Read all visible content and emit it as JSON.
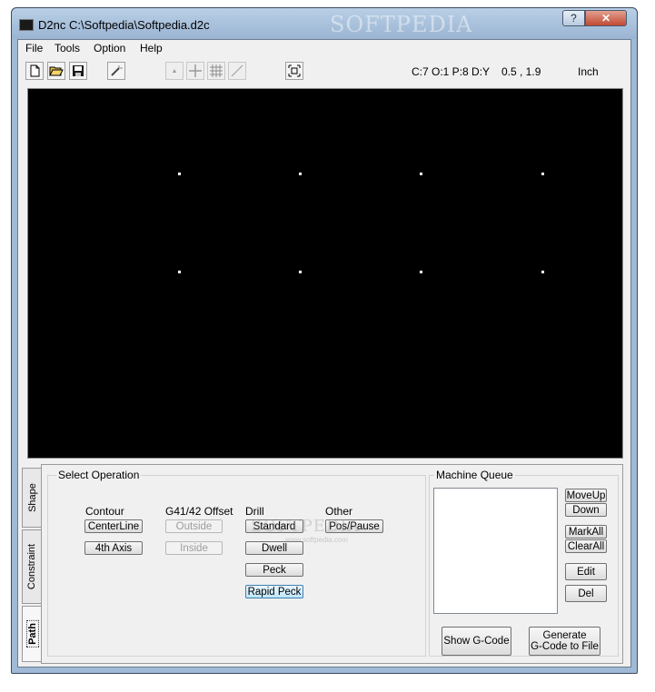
{
  "window": {
    "title": "D2nc C:\\Softpedia\\Softpedia.d2c",
    "watermark": "SOFTPEDIA",
    "help_button": "?",
    "close_button": "✕"
  },
  "menu": [
    "File",
    "Tools",
    "Option",
    "Help"
  ],
  "toolbar": {
    "icons": [
      "new-file-icon",
      "open-folder-icon",
      "save-disk-icon",
      "magic-wand-icon",
      "point-icon",
      "crosshair-icon",
      "grid-icon",
      "diagonal-line-icon",
      "zoom-fit-icon"
    ],
    "status": {
      "counts": "C:7  O:1  P:8  D:Y",
      "coords": "0.5 , 1.9",
      "units": "Inch"
    }
  },
  "canvas": {
    "background": "#000000",
    "point_color": "#ffffff",
    "point_count": 8
  },
  "side_tabs": [
    "Shape",
    "Constraint",
    "Path"
  ],
  "operation": {
    "title": "Select Operation",
    "columns": {
      "contour": {
        "label": "Contour",
        "buttons": [
          "CenterLine",
          "4th Axis"
        ]
      },
      "offset": {
        "label": "G41/42 Offset",
        "buttons": [
          "Outside",
          "Inside"
        ]
      },
      "drill": {
        "label": "Drill",
        "buttons": [
          "Standard",
          "Dwell",
          "Peck",
          "Rapid Peck"
        ]
      },
      "other": {
        "label": "Other",
        "buttons": [
          "Pos/Pause"
        ]
      }
    }
  },
  "queue": {
    "title": "Machine Queue",
    "buttons": {
      "move_up": "MoveUp",
      "down": "Down",
      "mark_all": "MarkAll",
      "clear_all": "ClearAll",
      "edit": "Edit",
      "del": "Del"
    }
  },
  "actions": {
    "show_gcode": "Show G-Code",
    "generate_line1": "Generate",
    "generate_line2": "G-Code to File"
  },
  "overlay_watermark": {
    "main": "SOFTPEDIA",
    "sub": "www.softpedia.com"
  },
  "colors": {
    "title_bar": "#9fb9d6",
    "close_button": "#c24a33",
    "canvas": "#000000"
  }
}
